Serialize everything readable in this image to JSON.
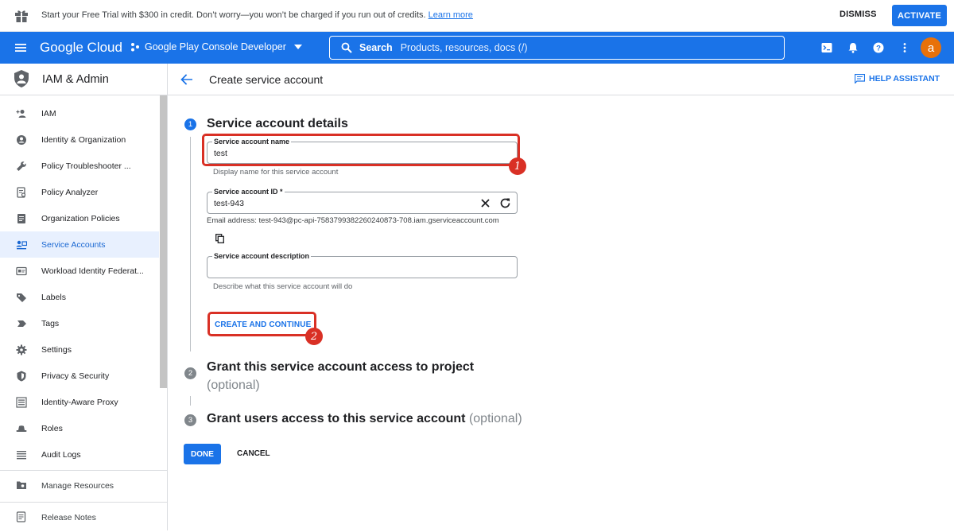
{
  "banner": {
    "message": "Start your Free Trial with $300 in credit. Don’t worry—you won’t be charged if you run out of credits.",
    "learn_more": "Learn more",
    "dismiss": "DISMISS",
    "activate": "ACTIVATE"
  },
  "topbar": {
    "brand": "Google Cloud",
    "project": "Google Play Console Developer",
    "search_label": "Search",
    "search_placeholder": "Products, resources, docs (/)",
    "avatar_letter": "a"
  },
  "sidebar": {
    "title": "IAM & Admin",
    "items": [
      {
        "label": "IAM",
        "icon": "person-add-icon"
      },
      {
        "label": "Identity & Organization",
        "icon": "account-circle-icon"
      },
      {
        "label": "Policy Troubleshooter ...",
        "icon": "wrench-icon"
      },
      {
        "label": "Policy Analyzer",
        "icon": "policy-analyzer-icon"
      },
      {
        "label": "Organization Policies",
        "icon": "document-icon"
      },
      {
        "label": "Service Accounts",
        "icon": "service-account-icon"
      },
      {
        "label": "Workload Identity Federat...",
        "icon": "id-card-icon"
      },
      {
        "label": "Labels",
        "icon": "label-icon"
      },
      {
        "label": "Tags",
        "icon": "tag-icon"
      },
      {
        "label": "Settings",
        "icon": "gear-icon"
      },
      {
        "label": "Privacy & Security",
        "icon": "shield-icon"
      },
      {
        "label": "Identity-Aware Proxy",
        "icon": "proxy-icon"
      },
      {
        "label": "Roles",
        "icon": "hat-icon"
      },
      {
        "label": "Audit Logs",
        "icon": "list-icon"
      }
    ],
    "manage_resources": "Manage Resources",
    "release_notes": "Release Notes"
  },
  "main": {
    "page_title": "Create service account",
    "help_assistant": "HELP ASSISTANT",
    "step1": {
      "number": "1",
      "title": "Service account details",
      "name_label": "Service account name",
      "name_value": "test",
      "name_hint": "Display name for this service account",
      "id_label": "Service account ID *",
      "id_value": "test-943",
      "email": "Email address: test-943@pc-api-7583799382260240873-708.iam.gserviceaccount.com",
      "desc_label": "Service account description",
      "desc_value": "",
      "desc_hint": "Describe what this service account will do",
      "create_button": "CREATE AND CONTINUE"
    },
    "step2": {
      "number": "2",
      "title": "Grant this service account access to project",
      "optional": "(optional)"
    },
    "step3": {
      "number": "3",
      "title": "Grant users access to this service account",
      "optional": "(optional)"
    },
    "done": "DONE",
    "cancel": "CANCEL"
  },
  "annotations": {
    "marker1": "1",
    "marker2": "2",
    "color": "#d93025"
  },
  "colors": {
    "brand_blue": "#1a73e8",
    "active_bg": "#e8f0fe",
    "avatar": "#e8710a"
  }
}
